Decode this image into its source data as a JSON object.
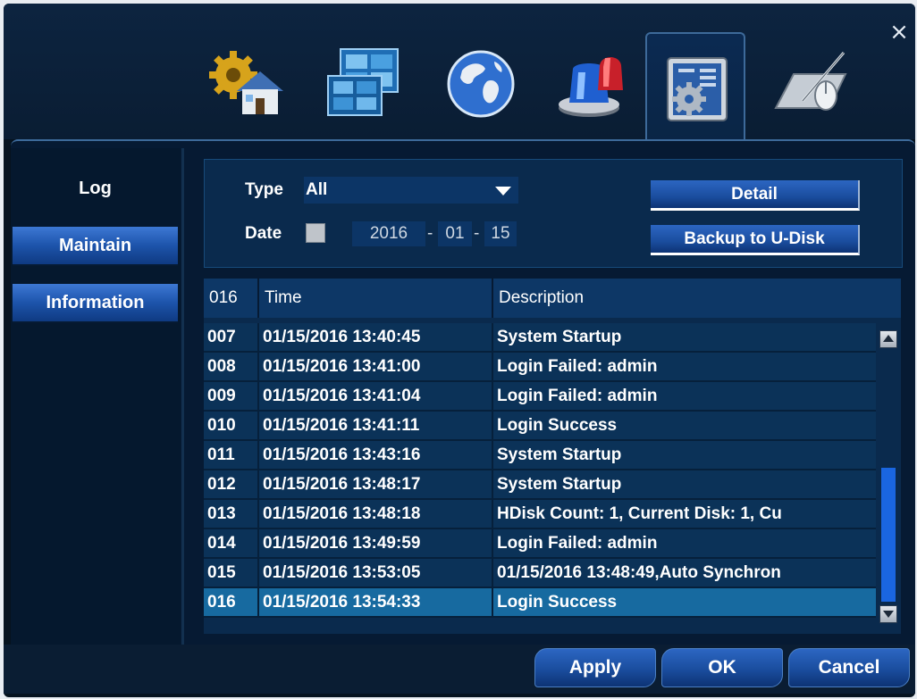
{
  "window": {
    "close_label": "×"
  },
  "toolbar": {
    "tabs": [
      {
        "name": "general-settings",
        "icon": "gear-house-icon"
      },
      {
        "name": "display-settings",
        "icon": "monitors-icon"
      },
      {
        "name": "network-settings",
        "icon": "globe-icon"
      },
      {
        "name": "alarm-settings",
        "icon": "alarm-siren-icon"
      },
      {
        "name": "system-maintenance",
        "icon": "system-gear-icon",
        "active": true
      },
      {
        "name": "advanced-tools",
        "icon": "pen-mouse-icon"
      }
    ]
  },
  "sidebar": {
    "items": [
      {
        "label": "Log"
      },
      {
        "label": "Maintain"
      },
      {
        "label": "Information"
      }
    ]
  },
  "filter": {
    "type_label": "Type",
    "type_value": "All",
    "date_label": "Date",
    "date_year": "2016",
    "date_month": "01",
    "date_day": "15",
    "date_sep": "-",
    "detail_label": "Detail",
    "backup_label": "Backup to U-Disk"
  },
  "table": {
    "headers": [
      "016",
      "Time",
      "Description"
    ],
    "rows": [
      {
        "num": "007",
        "time": "01/15/2016 13:40:45",
        "desc": "System Startup"
      },
      {
        "num": "008",
        "time": "01/15/2016 13:41:00",
        "desc": "Login Failed: admin"
      },
      {
        "num": "009",
        "time": "01/15/2016 13:41:04",
        "desc": "Login Failed: admin"
      },
      {
        "num": "010",
        "time": "01/15/2016 13:41:11",
        "desc": "Login Success"
      },
      {
        "num": "011",
        "time": "01/15/2016 13:43:16",
        "desc": "System Startup"
      },
      {
        "num": "012",
        "time": "01/15/2016 13:48:17",
        "desc": "System Startup"
      },
      {
        "num": "013",
        "time": "01/15/2016 13:48:18",
        "desc": "HDisk Count: 1, Current Disk: 1, Cu"
      },
      {
        "num": "014",
        "time": "01/15/2016 13:49:59",
        "desc": "Login Failed: admin"
      },
      {
        "num": "015",
        "time": "01/15/2016 13:53:05",
        "desc": "01/15/2016 13:48:49,Auto Synchron"
      },
      {
        "num": "016",
        "time": "01/15/2016 13:54:33",
        "desc": "Login Success",
        "selected": true
      }
    ],
    "scroll_position": 1.0
  },
  "actions": {
    "apply_label": "Apply",
    "ok_label": "OK",
    "cancel_label": "Cancel"
  },
  "colors": {
    "accent": "#1a4d9e",
    "selected_row": "#176aa0",
    "panel_bg": "#061a33"
  }
}
